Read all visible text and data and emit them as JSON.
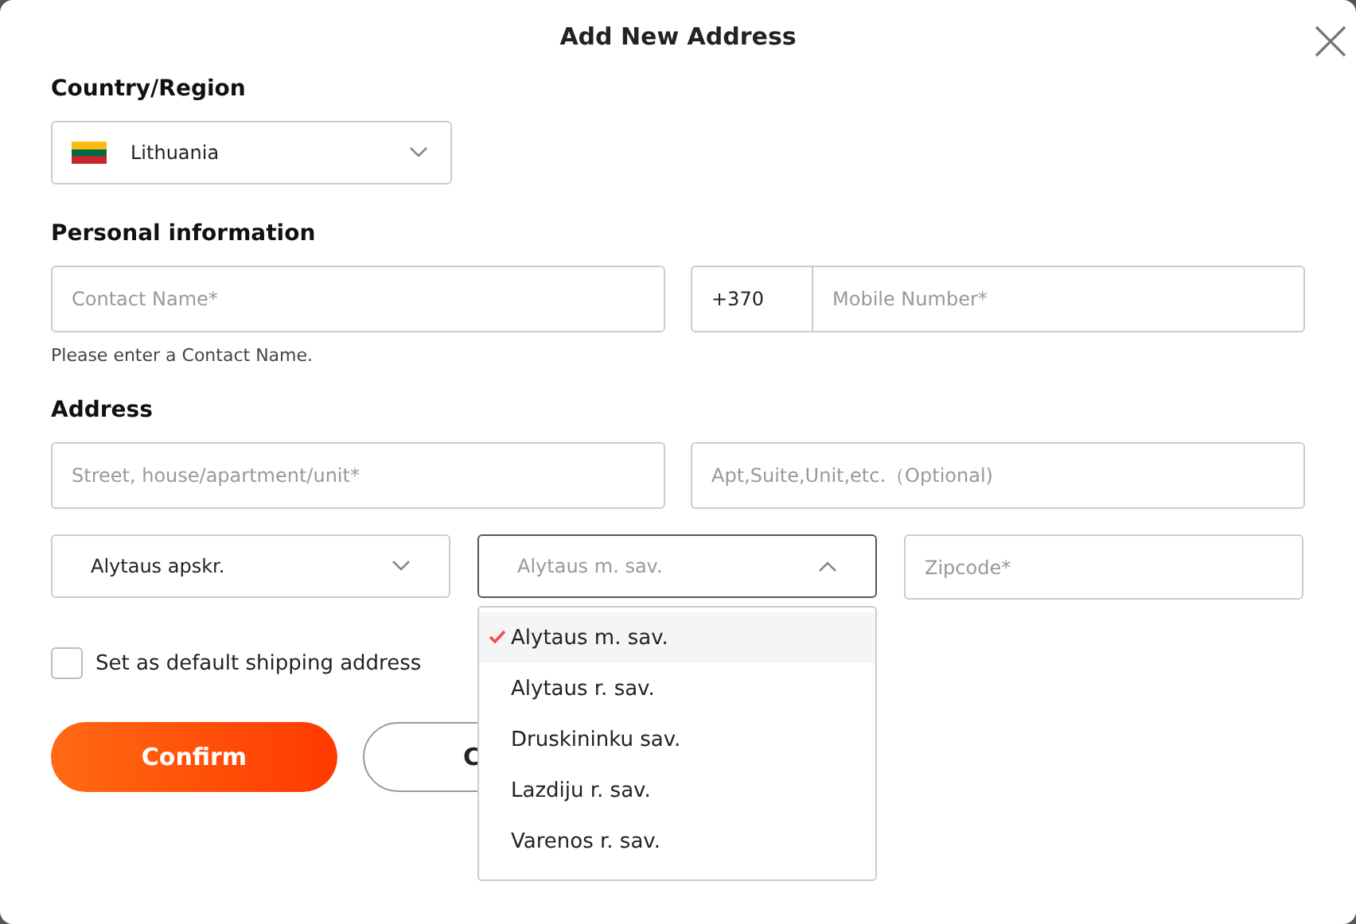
{
  "dialog": {
    "title": "Add New Address"
  },
  "country_section": {
    "label": "Country/Region",
    "country": {
      "value": "Lithuania",
      "expanded": false
    }
  },
  "personal_section": {
    "label": "Personal information",
    "contact_name": {
      "placeholder": "Contact Name*"
    },
    "phone_code": {
      "value": "+370"
    },
    "mobile": {
      "placeholder": "Mobile Number*"
    },
    "error": "Please enter a Contact Name."
  },
  "address_section": {
    "label": "Address",
    "street": {
      "placeholder": "Street, house/apartment/unit*"
    },
    "apt": {
      "placeholder": "Apt,Suite,Unit,etc.（Optional)"
    },
    "region": {
      "value": "Alytaus apskr.",
      "expanded": false
    },
    "municipality": {
      "placeholder": "Alytaus m. sav.",
      "expanded": true,
      "options": [
        {
          "label": "Alytaus m. sav.",
          "selected": true
        },
        {
          "label": "Alytaus r. sav.",
          "selected": false
        },
        {
          "label": "Druskininku sav.",
          "selected": false
        },
        {
          "label": "Lazdiju r. sav.",
          "selected": false
        },
        {
          "label": "Varenos r. sav.",
          "selected": false
        }
      ]
    },
    "zipcode": {
      "placeholder": "Zipcode*"
    }
  },
  "default_address": {
    "label": "Set as default shipping address",
    "checked": false
  },
  "buttons": [
    {
      "label": "Confirm",
      "kind": "primary"
    },
    {
      "label": "C",
      "kind": "secondary"
    }
  ]
}
